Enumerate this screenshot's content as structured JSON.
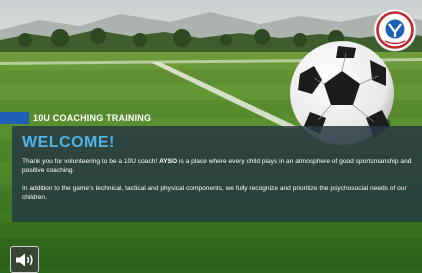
{
  "slide": {
    "banner_label": "10U COACHING TRAINING",
    "title": "WELCOME!",
    "paragraph_1_intro": "Thank you for volunteering to be a 10U coach! ",
    "paragraph_1_brand": "AYSO",
    "paragraph_1_rest": " is a place where every child plays in an atmosphere of good sportsmanship and positive coaching.",
    "paragraph_2": "In addition to the game's technical, tactical and physical components, we fully recognize and prioritize the psychosocial needs of our children."
  },
  "logo": {
    "lettering": "AYSO"
  },
  "controls": {
    "audio_icon": "speaker-volume-icon"
  },
  "colors": {
    "accent_blue": "#1f5fb8",
    "title_blue": "#4fb3e6",
    "panel": "#283a42"
  }
}
